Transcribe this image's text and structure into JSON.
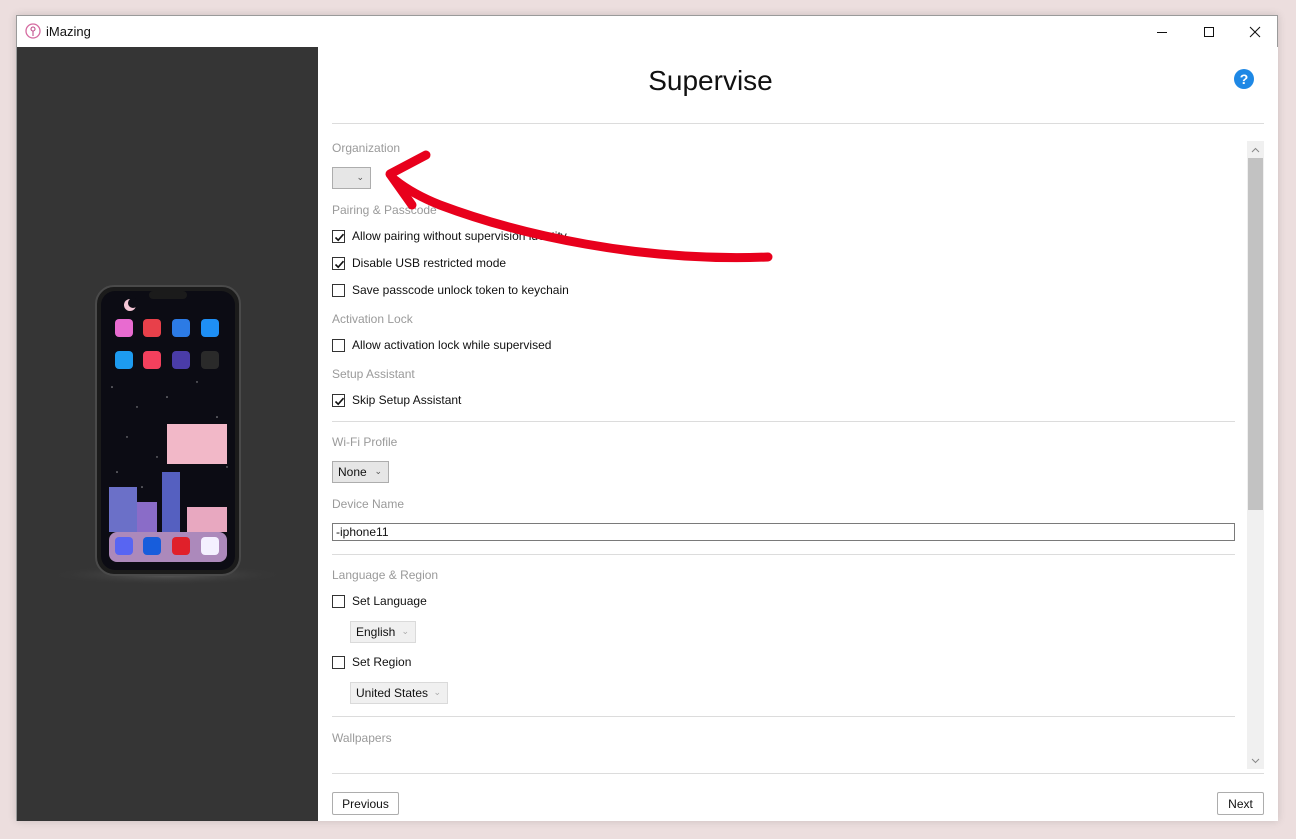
{
  "window": {
    "title": "iMazing",
    "controls": {
      "minimize": "minimize-icon",
      "maximize": "maximize-icon",
      "close": "close-icon"
    }
  },
  "page": {
    "title": "Supervise",
    "help_icon": "?"
  },
  "sections": {
    "organization": {
      "label": "Organization",
      "value": ""
    },
    "pairing": {
      "label": "Pairing & Passcode",
      "options": [
        {
          "label": "Allow pairing without supervision identity",
          "checked": true
        },
        {
          "label": "Disable USB restricted mode",
          "checked": true
        },
        {
          "label": "Save passcode unlock token to keychain",
          "checked": false
        }
      ]
    },
    "activation_lock": {
      "label": "Activation Lock",
      "option": {
        "label": "Allow activation lock while supervised",
        "checked": false
      }
    },
    "setup_assistant": {
      "label": "Setup Assistant",
      "option": {
        "label": "Skip Setup Assistant",
        "checked": true
      }
    },
    "wifi": {
      "label": "Wi-Fi Profile",
      "value": "None"
    },
    "device_name": {
      "label": "Device Name",
      "value": "-iphone11"
    },
    "language_region": {
      "label": "Language & Region",
      "set_language": {
        "label": "Set Language",
        "checked": false,
        "value": "English"
      },
      "set_region": {
        "label": "Set Region",
        "checked": false,
        "value": "United States"
      }
    },
    "wallpapers": {
      "label": "Wallpapers"
    }
  },
  "footer": {
    "previous": "Previous",
    "next": "Next"
  },
  "colors": {
    "accent_blue": "#1e88e5",
    "annotation_red": "#e8001c",
    "left_pane": "#353535"
  }
}
